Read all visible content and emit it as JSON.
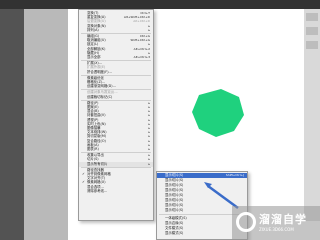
{
  "main_menu": {
    "items": [
      {
        "label": "变换(T)",
        "shortcut": "Ctrl+T",
        "disabled": false
      },
      {
        "label": "重复变换(A)",
        "shortcut": "Alt+Shift+Ctrl+D",
        "disabled": false
      },
      {
        "label": "后退变换(U)",
        "shortcut": "Alt+Ctrl+D",
        "disabled": true
      },
      {
        "label": "变换对象(N)",
        "shortcut": "",
        "disabled": false,
        "submenu": true
      },
      {
        "label": "排列(A)",
        "shortcut": "",
        "disabled": false,
        "submenu": true
      },
      {
        "sep": true
      },
      {
        "label": "编组(G)",
        "shortcut": "Ctrl+G",
        "disabled": false
      },
      {
        "label": "取消编组(U)",
        "shortcut": "Shift+Ctrl+G",
        "disabled": false
      },
      {
        "label": "锁定(L)",
        "shortcut": "",
        "disabled": false,
        "submenu": true
      },
      {
        "label": "全部解锁(K)",
        "shortcut": "Alt+Ctrl+2",
        "disabled": false
      },
      {
        "label": "隐藏(H)",
        "shortcut": "",
        "disabled": false,
        "submenu": true
      },
      {
        "label": "显示全部",
        "shortcut": "Alt+Ctrl+3",
        "disabled": false
      },
      {
        "sep": true
      },
      {
        "label": "扩展(X)...",
        "shortcut": "",
        "disabled": false
      },
      {
        "label": "扩展外观(E)",
        "shortcut": "",
        "disabled": true
      },
      {
        "label": "拼合透明度(F)...",
        "shortcut": "",
        "disabled": false
      },
      {
        "sep": true
      },
      {
        "label": "像素级优化",
        "shortcut": "",
        "disabled": false
      },
      {
        "label": "栅格化(Z)...",
        "shortcut": "",
        "disabled": false
      },
      {
        "label": "创建渐变网格(D)...",
        "shortcut": "",
        "disabled": false
      },
      {
        "sep": true
      },
      {
        "label": "创建对象马赛克(J)...",
        "shortcut": "",
        "disabled": true
      },
      {
        "label": "创建裁切标记(C)",
        "shortcut": "",
        "disabled": false
      },
      {
        "sep": true
      },
      {
        "label": "路径(P)",
        "shortcut": "",
        "disabled": false,
        "submenu": true
      },
      {
        "label": "图案(E)",
        "shortcut": "",
        "disabled": false,
        "submenu": true
      },
      {
        "label": "混合(B)",
        "shortcut": "",
        "disabled": false,
        "submenu": true
      },
      {
        "label": "封套扭曲(V)",
        "shortcut": "",
        "disabled": false,
        "submenu": true
      },
      {
        "label": "透视(P)",
        "shortcut": "",
        "disabled": false,
        "submenu": true
      },
      {
        "label": "实时上色(N)",
        "shortcut": "",
        "disabled": false,
        "submenu": true
      },
      {
        "label": "图像描摹",
        "shortcut": "",
        "disabled": false,
        "submenu": true
      },
      {
        "label": "文本绕排(W)",
        "shortcut": "",
        "disabled": false,
        "submenu": true
      },
      {
        "label": "剪切蒙版(M)",
        "shortcut": "",
        "disabled": false,
        "submenu": true
      },
      {
        "label": "复合路径(O)",
        "shortcut": "",
        "disabled": false,
        "submenu": true
      },
      {
        "label": "画板(A)",
        "shortcut": "",
        "disabled": false,
        "submenu": true
      },
      {
        "label": "图表(R)",
        "shortcut": "",
        "disabled": false,
        "submenu": true
      },
      {
        "sep": true
      },
      {
        "label": "收集以导出",
        "shortcut": "",
        "disabled": false,
        "submenu": true
      },
      {
        "label": "切片(S)",
        "shortcut": "",
        "disabled": false,
        "submenu": true
      },
      {
        "label": "显示所有切片",
        "shortcut": "",
        "disabled": false,
        "highlight": true,
        "submenu": true
      },
      {
        "sep": true
      },
      {
        "label": "路径查找器",
        "shortcut": "",
        "disabled": false
      },
      {
        "label": "对齐到像素网格",
        "shortcut": "",
        "disabled": false,
        "check": true
      },
      {
        "label": "文字对齐(T)",
        "shortcut": "",
        "disabled": false
      },
      {
        "label": "像素网格(X)",
        "shortcut": "",
        "disabled": false,
        "check": true
      },
      {
        "label": "混合选项...",
        "shortcut": "",
        "disabled": false
      },
      {
        "label": "清除参考线...",
        "shortcut": "",
        "disabled": false
      }
    ]
  },
  "sub_menu": {
    "items": [
      {
        "label": "显示切片(S)",
        "shortcut": "Shift+Ctrl+J",
        "highlight": true
      },
      {
        "label": "显示切片(S)",
        "shortcut": ""
      },
      {
        "label": "显示切片(S)",
        "shortcut": ""
      },
      {
        "label": "显示切片(S)",
        "shortcut": ""
      },
      {
        "label": "显示切片(S)",
        "shortcut": ""
      },
      {
        "label": "显示切片(S)",
        "shortcut": ""
      },
      {
        "label": "显示切片(S)",
        "shortcut": ""
      },
      {
        "label": "显示切片(S)",
        "shortcut": ""
      },
      {
        "sep": true
      },
      {
        "label": "一体级模式(S)",
        "shortcut": ""
      },
      {
        "label": "显示边缘(S)",
        "shortcut": ""
      },
      {
        "label": "文件模式(S)",
        "shortcut": ""
      },
      {
        "label": "显示模式(S)",
        "shortcut": ""
      }
    ]
  },
  "shape": {
    "color": "#1fd17e",
    "type": "heptagon"
  },
  "watermark": {
    "title": "溜溜自学",
    "subtitle": "ZIXUE.3D66.COM"
  },
  "colors": {
    "menu_bg": "#f0f0f0",
    "highlight": "#3a6cc9",
    "shape": "#1fd17e"
  }
}
